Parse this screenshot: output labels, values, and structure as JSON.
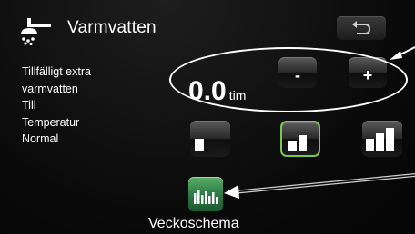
{
  "header": {
    "title": "Varmvatten",
    "title_icon": "shower-icon",
    "back_icon": "back-arrow-icon"
  },
  "info_labels": [
    "Tillfälligt extra",
    "varmvatten",
    "Till",
    "Temperatur",
    "Normal"
  ],
  "extra_hot_water": {
    "value": "0.0",
    "unit": "tim",
    "minus_label": "-",
    "plus_label": "+"
  },
  "temperature_levels": [
    {
      "icon": "temperature-level-low-icon",
      "selected": false
    },
    {
      "icon": "temperature-level-normal-icon",
      "selected": true
    },
    {
      "icon": "temperature-level-high-icon",
      "selected": false
    }
  ],
  "schedule": {
    "label": "Veckoschema",
    "icon": "week-schedule-icon"
  },
  "colors": {
    "selected_border": "#7ec44d",
    "schedule_button": "#2e7a45",
    "background": "#0b0b0b",
    "text": "#ffffff"
  }
}
